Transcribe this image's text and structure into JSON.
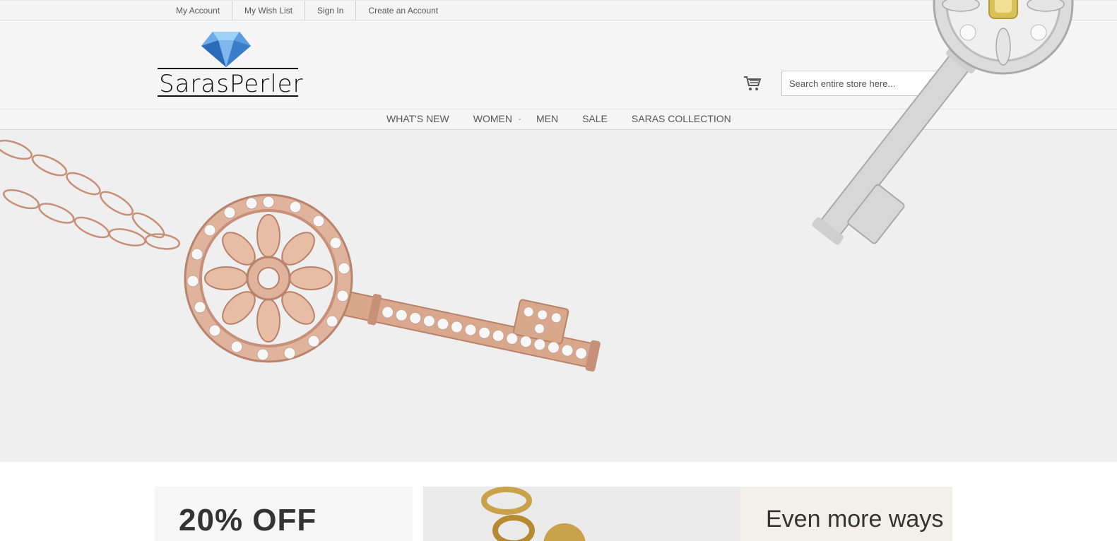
{
  "top_links": [
    "My Account",
    "My Wish List",
    "Sign In",
    "Create an Account"
  ],
  "logo": {
    "text": "SarasPerler"
  },
  "search": {
    "placeholder": "Search entire store here..."
  },
  "nav": [
    "WHAT'S NEW",
    "WOMEN",
    "MEN",
    "SALE",
    "SARAS COLLECTION"
  ],
  "icons": {
    "cart": "cart-icon",
    "search": "search-icon",
    "logo": "diamond-icon",
    "submenu": "chevron-down-icon"
  },
  "promos": {
    "first": "20% OFF",
    "third": "Even more ways"
  },
  "colors": {
    "rose_gold": "#d9a88c",
    "silver": "#c9c9c9",
    "header_bg": "#f5f5f5",
    "hero_bg": "#efefef"
  }
}
